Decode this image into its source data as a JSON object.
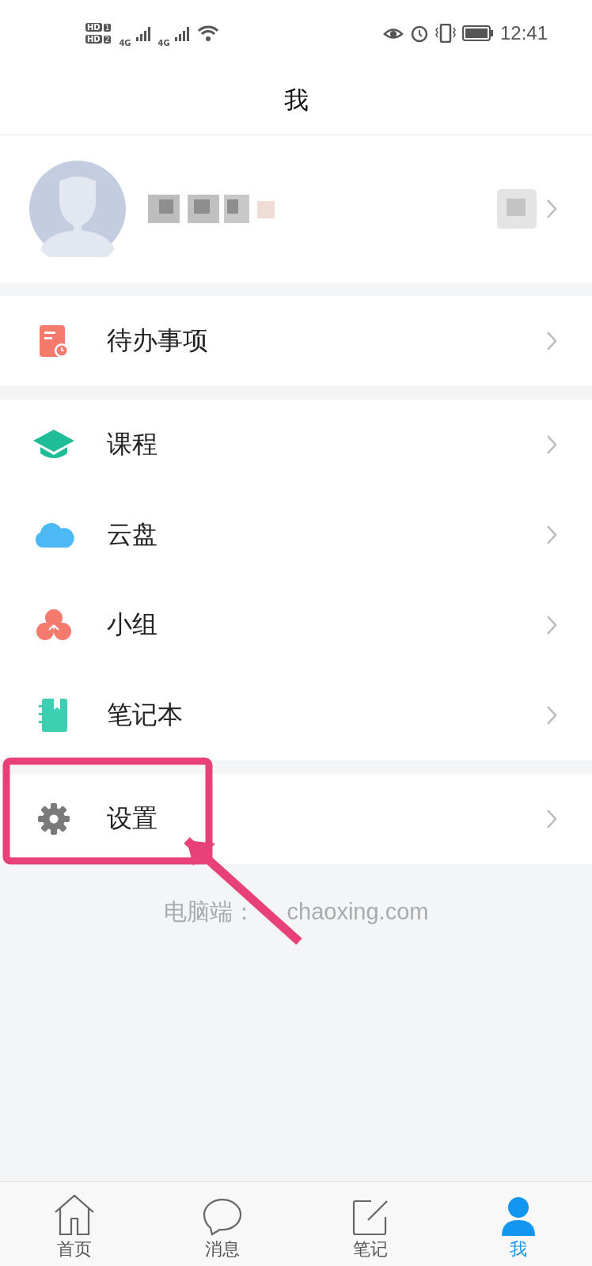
{
  "status_bar": {
    "sims": [
      {
        "label": "HD",
        "slot": "1"
      },
      {
        "label": "HD",
        "slot": "2"
      }
    ],
    "networks": [
      "4G",
      "4G"
    ],
    "time": "12:41"
  },
  "header": {
    "title": "我"
  },
  "profile": {
    "kind": "blurred"
  },
  "sections": [
    {
      "items": [
        {
          "label": "待办事项"
        }
      ]
    },
    {
      "items": [
        {
          "label": "课程"
        },
        {
          "label": "云盘"
        },
        {
          "label": "小组"
        },
        {
          "label": "笔记本"
        }
      ]
    },
    {
      "items": [
        {
          "label": "设置"
        }
      ]
    }
  ],
  "footer": {
    "label": "电脑端：",
    "address": "chaoxing.com"
  },
  "annotation": {
    "kind": "highlight-arrow"
  },
  "tab_bar": [
    {
      "label": "首页",
      "selected": false
    },
    {
      "label": "消息",
      "selected": false
    },
    {
      "label": "笔记",
      "selected": false
    },
    {
      "label": "我",
      "selected": true
    }
  ]
}
